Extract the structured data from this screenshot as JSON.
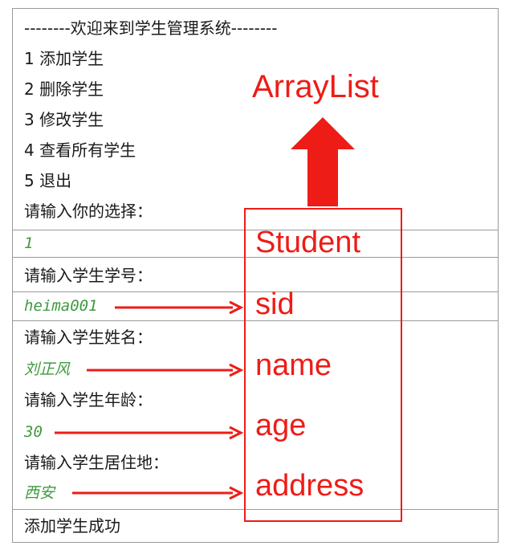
{
  "console": {
    "header": "--------欢迎来到学生管理系统--------",
    "menu": [
      "1 添加学生",
      "2 删除学生",
      "3 修改学生",
      "4 查看所有学生",
      "5 退出"
    ],
    "prompt_choice": "请输入你的选择：",
    "input_choice": "1",
    "prompt_sid": "请输入学生学号：",
    "input_sid": "heima001",
    "prompt_name": "请输入学生姓名：",
    "input_name": "刘正风",
    "prompt_age": "请输入学生年龄：",
    "input_age": "30",
    "prompt_address": "请输入学生居住地：",
    "input_address": "西安",
    "result": "添加学生成功"
  },
  "diagram": {
    "container_label": "ArrayList",
    "object_label": "Student",
    "fields": [
      "sid",
      "name",
      "age",
      "address"
    ],
    "accent_color": "#ee1c17",
    "input_color": "#3f9a3f"
  }
}
